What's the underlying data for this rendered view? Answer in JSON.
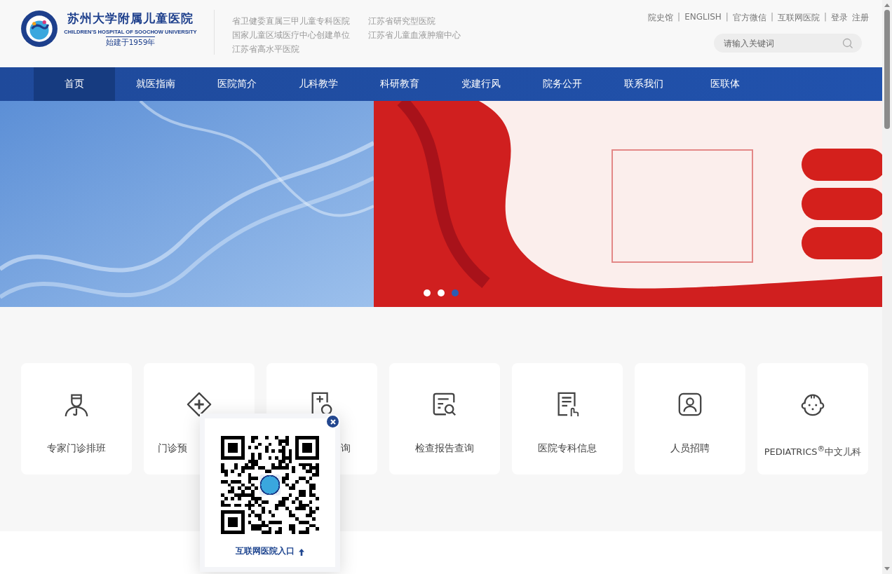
{
  "header": {
    "logo": {
      "title": "苏州大学附属儿童医院",
      "subtitle": "CHILDREN'S HOSPITAL OF SOOCHOW UNIVERSITY",
      "founded": "始建于1959年"
    },
    "honors": [
      "省卫健委直属三甲儿童专科医院",
      "江苏省研究型医院",
      "国家儿童区域医疗中心创建单位",
      "江苏省儿童血液肿瘤中心",
      "江苏省高水平医院"
    ],
    "top_links": [
      {
        "kind": "link",
        "label": "院史馆"
      },
      {
        "kind": "separator",
        "label": "|"
      },
      {
        "kind": "link",
        "label": "ENGLISH"
      },
      {
        "kind": "separator",
        "label": "|"
      },
      {
        "kind": "link",
        "label": "官方微信"
      },
      {
        "kind": "separator",
        "label": "|"
      },
      {
        "kind": "link",
        "label": "互联网医院"
      },
      {
        "kind": "separator",
        "label": "|"
      },
      {
        "kind": "link",
        "label": "登录"
      },
      {
        "kind": "link",
        "label": "注册"
      }
    ],
    "search": {
      "placeholder": "请输入关键词"
    }
  },
  "nav": [
    {
      "label": "首页",
      "selected": true
    },
    {
      "label": "就医指南",
      "selected": false
    },
    {
      "label": "医院简介",
      "selected": false
    },
    {
      "label": "儿科教学",
      "selected": false
    },
    {
      "label": "科研教育",
      "selected": false
    },
    {
      "label": "党建行风",
      "selected": false
    },
    {
      "label": "院务公开",
      "selected": false
    },
    {
      "label": "联系我们",
      "selected": false
    },
    {
      "label": "医联体",
      "selected": false
    }
  ],
  "banner": {
    "slides": [
      {
        "selected": false
      },
      {
        "selected": false
      },
      {
        "selected": true
      }
    ]
  },
  "services": [
    {
      "label": "专家门诊排班"
    },
    {
      "label": "门诊预"
    },
    {
      "label": "询"
    },
    {
      "label": "检查报告查询"
    },
    {
      "label": "医院专科信息"
    },
    {
      "label": "人员招聘"
    },
    {
      "label": "PEDIATRICS$^{®}$中文儿科"
    }
  ],
  "qr_popup": {
    "link": "互联网医院入口"
  }
}
